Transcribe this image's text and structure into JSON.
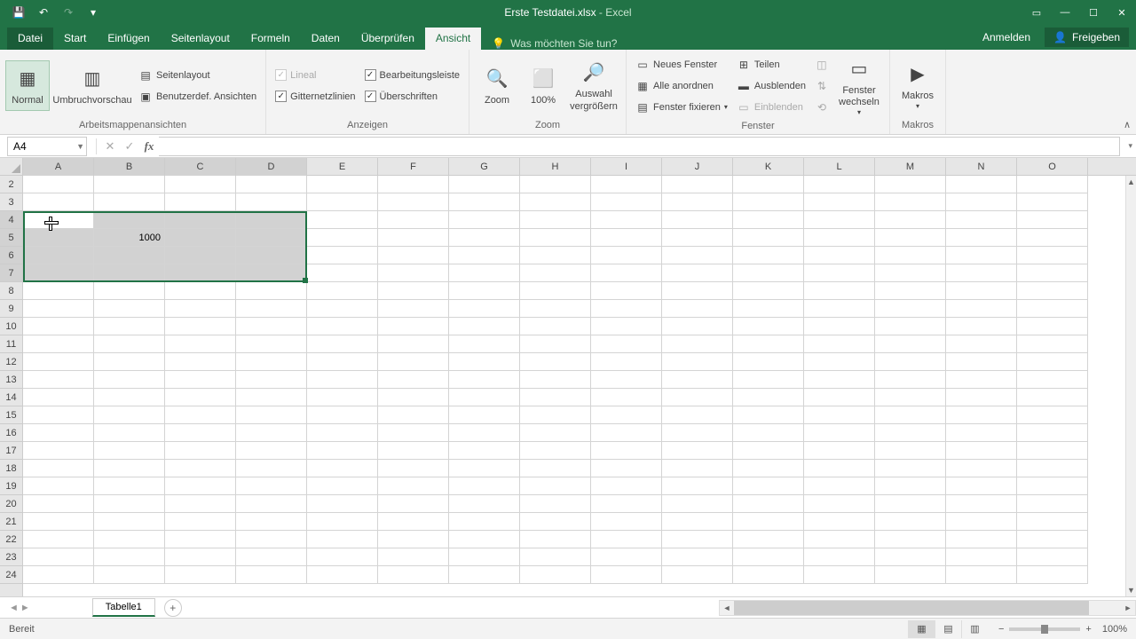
{
  "title": {
    "file": "Erste Testdatei.xlsx",
    "app": "Excel",
    "sep": " - "
  },
  "qat": {
    "save": "💾",
    "undo": "↶",
    "redo": "↷",
    "custom": "▾"
  },
  "win": {
    "ribbon_opts": "▭",
    "min": "—",
    "max": "☐",
    "close": "✕"
  },
  "tabs": {
    "datei": "Datei",
    "start": "Start",
    "einfuegen": "Einfügen",
    "seitenlayout": "Seitenlayout",
    "formeln": "Formeln",
    "daten": "Daten",
    "ueberpruefen": "Überprüfen",
    "ansicht": "Ansicht",
    "tellme_icon": "💡",
    "tellme": "Was möchten Sie tun?",
    "anmelden": "Anmelden",
    "freigeben": "Freigeben",
    "share_icon": "👤"
  },
  "ribbon": {
    "views": {
      "normal": "Normal",
      "umbruch": "Umbruchvorschau",
      "seitenlayout": "Seitenlayout",
      "benutzerdef": "Benutzerdef. Ansichten",
      "label": "Arbeitsmappenansichten"
    },
    "anzeigen": {
      "lineal": "Lineal",
      "bearbeitungsleiste": "Bearbeitungsleiste",
      "gitternetzlinien": "Gitternetzlinien",
      "ueberschriften": "Überschriften",
      "label": "Anzeigen"
    },
    "zoom": {
      "zoom": "Zoom",
      "p100": "100%",
      "auswahl": "Auswahl vergrößern",
      "label": "Zoom"
    },
    "fenster": {
      "neues": "Neues Fenster",
      "alle": "Alle anordnen",
      "fixieren": "Fenster fixieren",
      "teilen": "Teilen",
      "ausblenden": "Ausblenden",
      "einblenden": "Einblenden",
      "wechseln": "Fenster wechseln",
      "label": "Fenster"
    },
    "makros": {
      "makros": "Makros",
      "label": "Makros"
    }
  },
  "formula_bar": {
    "name_box": "A4",
    "cancel": "✕",
    "enter": "✓",
    "fx": "fx",
    "value": ""
  },
  "grid": {
    "columns": [
      "A",
      "B",
      "C",
      "D",
      "E",
      "F",
      "G",
      "H",
      "I",
      "J",
      "K",
      "L",
      "M",
      "N",
      "O"
    ],
    "rows": [
      "2",
      "3",
      "4",
      "5",
      "6",
      "7",
      "8",
      "9",
      "10",
      "11",
      "12",
      "13",
      "14",
      "15",
      "16",
      "17",
      "18",
      "19",
      "20",
      "21",
      "22",
      "23",
      "24"
    ],
    "selected_cols": [
      "A",
      "B",
      "C",
      "D"
    ],
    "selected_rows": [
      "4",
      "5",
      "6",
      "7"
    ],
    "active_cell": "A4",
    "cell_b5": "1000"
  },
  "sheet": {
    "nav_prev": "◄",
    "nav_next": "►",
    "tab1": "Tabelle1",
    "add": "+"
  },
  "status": {
    "ready": "Bereit",
    "zoom_minus": "−",
    "zoom_plus": "+",
    "zoom_pct": "100%"
  }
}
